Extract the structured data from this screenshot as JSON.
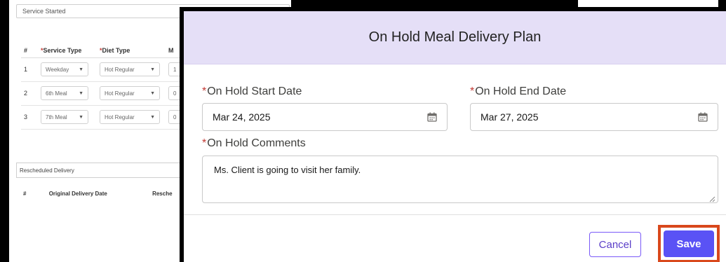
{
  "background": {
    "status_field": "Service Started",
    "table": {
      "headers": [
        "#",
        "Service Type",
        "Diet Type",
        "M"
      ],
      "required_headers": [
        "Service Type",
        "Diet Type"
      ],
      "rows": [
        {
          "num": "1",
          "service_type": "Weekday",
          "diet_type": "Hot Regular",
          "m": "1"
        },
        {
          "num": "2",
          "service_type": "6th Meal",
          "diet_type": "Hot Regular",
          "m": "0"
        },
        {
          "num": "3",
          "service_type": "7th Meal",
          "diet_type": "Hot Regular",
          "m": "0"
        }
      ]
    },
    "rescheduled_label": "Rescheduled Delivery",
    "rescheduled_headers": [
      "#",
      "Original Delivery Date",
      "Resche"
    ]
  },
  "modal": {
    "title": "On Hold Meal Delivery Plan",
    "start_label": "On Hold Start Date",
    "start_value": "Mar 24, 2025",
    "end_label": "On Hold End Date",
    "end_value": "Mar 27, 2025",
    "comments_label": "On Hold Comments",
    "comments_value": "Ms. Client is going to visit her family.",
    "required_marker": "*",
    "cancel_label": "Cancel",
    "save_label": "Save"
  },
  "colors": {
    "header_bg": "#e5dff7",
    "save_bg": "#5a52f5",
    "highlight": "#d9481c",
    "required": "#c23934"
  },
  "icons": {
    "date_picker": "calendar-icon",
    "select_caret": "caret-down-icon",
    "resize": "resize-grip-icon"
  }
}
